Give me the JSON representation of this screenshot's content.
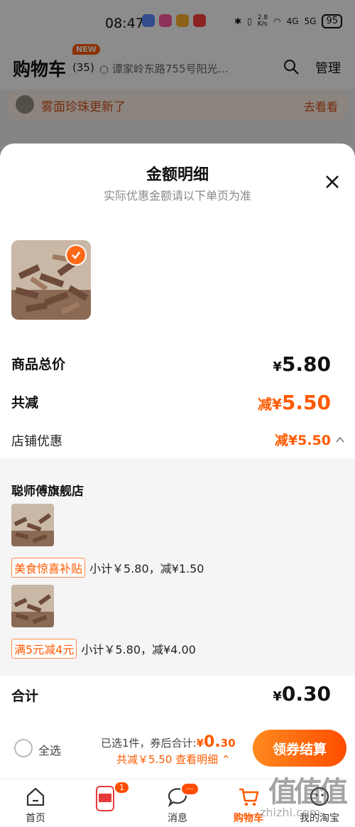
{
  "status_bar": {
    "time": "08:47",
    "net_speed": "2.8\nK/s",
    "net_1": "4G",
    "net_2": "5G",
    "battery": "95"
  },
  "cart_header": {
    "title": "购物车",
    "new_badge": "NEW",
    "count": "(35)",
    "address": "谭家岭东路755号阳光…",
    "manage": "管理"
  },
  "promo_row": {
    "text": "雾面珍珠更新了",
    "link": "去看看"
  },
  "sheet": {
    "title": "金额明细",
    "subtitle": "实际优惠金额请以下单页为准",
    "total_price_label": "商品总价",
    "total_price_prefix": "¥",
    "total_price_value": "5.80",
    "reduce_label": "共减",
    "reduce_prefix": "减¥",
    "reduce_value": "5.50",
    "shop_discount_label": "店铺优惠",
    "shop_discount_value": "减¥5.50",
    "shop_name": "聪师傅旗舰店",
    "items": [
      {
        "tag": "美食惊喜补贴",
        "detail": "小计￥5.80，减¥1.50"
      },
      {
        "tag": "满5元减4元",
        "detail": "小计￥5.80，减¥4.00"
      }
    ],
    "sum_label": "合计",
    "sum_prefix": "¥",
    "sum_value": "0.30"
  },
  "checkout": {
    "select_all": "全选",
    "selected_text": "已选1件，券后合计:",
    "after_coupon_prefix": "¥",
    "after_coupon_big": "0.",
    "after_coupon_small": "30",
    "discount_line": "共减￥5.50 查看明细",
    "button": "领券结算"
  },
  "tab_bar": {
    "tabs": [
      {
        "label": "首页"
      },
      {
        "label": ""
      },
      {
        "label": "消息",
        "badge": "···"
      },
      {
        "label": "购物车"
      },
      {
        "label": "我的淘宝"
      }
    ],
    "video_badge": "1"
  },
  "watermark": {
    "glyphs": "值值值",
    "text": "zhizhi.com"
  },
  "colors": {
    "accent": "#ff5a00",
    "button_start": "#ff8a1f",
    "button_end": "#ff4d00"
  }
}
